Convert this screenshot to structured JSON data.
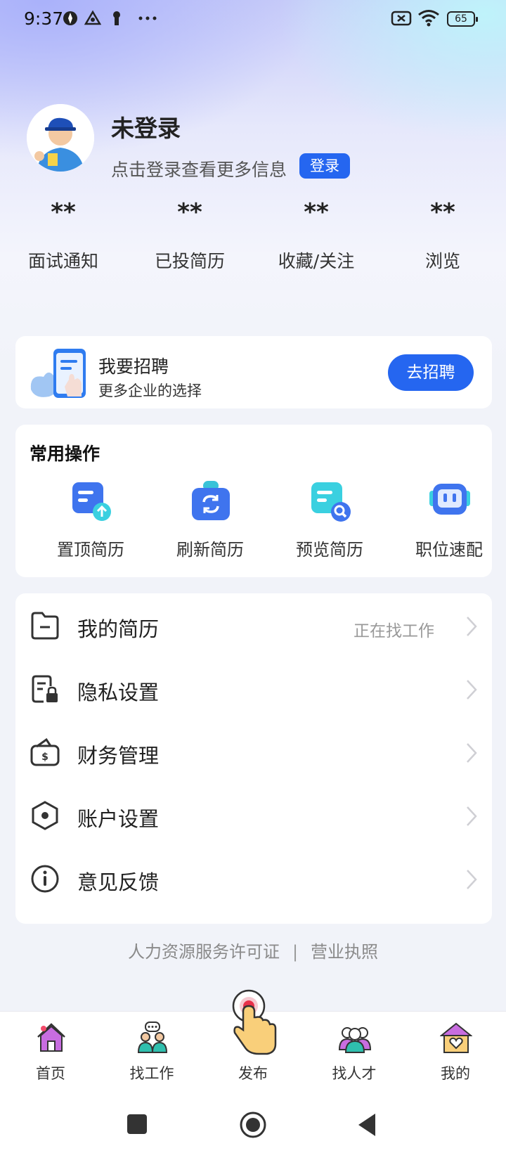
{
  "status_bar": {
    "time": "9:37",
    "battery": "65"
  },
  "profile": {
    "name": "未登录",
    "subtitle": "点击登录查看更多信息",
    "login_label": "登录"
  },
  "stats": [
    {
      "value": "**",
      "label": "面试通知"
    },
    {
      "value": "**",
      "label": "已投简历"
    },
    {
      "value": "**",
      "label": "收藏/关注"
    },
    {
      "value": "**",
      "label": "浏览"
    }
  ],
  "recruit": {
    "title": "我要招聘",
    "subtitle": "更多企业的选择",
    "button": "去招聘"
  },
  "common_ops": {
    "title": "常用操作",
    "items": [
      {
        "label": "置顶简历",
        "icon": "pin-resume-icon"
      },
      {
        "label": "刷新简历",
        "icon": "refresh-resume-icon"
      },
      {
        "label": "预览简历",
        "icon": "preview-resume-icon"
      },
      {
        "label": "职位速配",
        "icon": "job-match-icon"
      }
    ]
  },
  "menu": [
    {
      "label": "我的简历",
      "value": "正在找工作",
      "icon": "folder-icon"
    },
    {
      "label": "隐私设置",
      "value": "",
      "icon": "privacy-lock-icon"
    },
    {
      "label": "财务管理",
      "value": "",
      "icon": "wallet-icon"
    },
    {
      "label": "账户设置",
      "value": "",
      "icon": "settings-hex-icon"
    },
    {
      "label": "意见反馈",
      "value": "",
      "icon": "info-icon"
    }
  ],
  "footer": {
    "license": "人力资源服务许可证",
    "separator": "|",
    "business_license": "营业执照"
  },
  "bottom_nav": [
    {
      "label": "首页",
      "icon": "home-icon"
    },
    {
      "label": "找工作",
      "icon": "find-job-icon"
    },
    {
      "label": "发布",
      "icon": "publish-icon"
    },
    {
      "label": "找人才",
      "icon": "find-talent-icon"
    },
    {
      "label": "我的",
      "icon": "mine-icon"
    }
  ],
  "colors": {
    "primary": "#2566f0",
    "accent_purple": "#c86de0",
    "publish_red": "#e8304a"
  }
}
